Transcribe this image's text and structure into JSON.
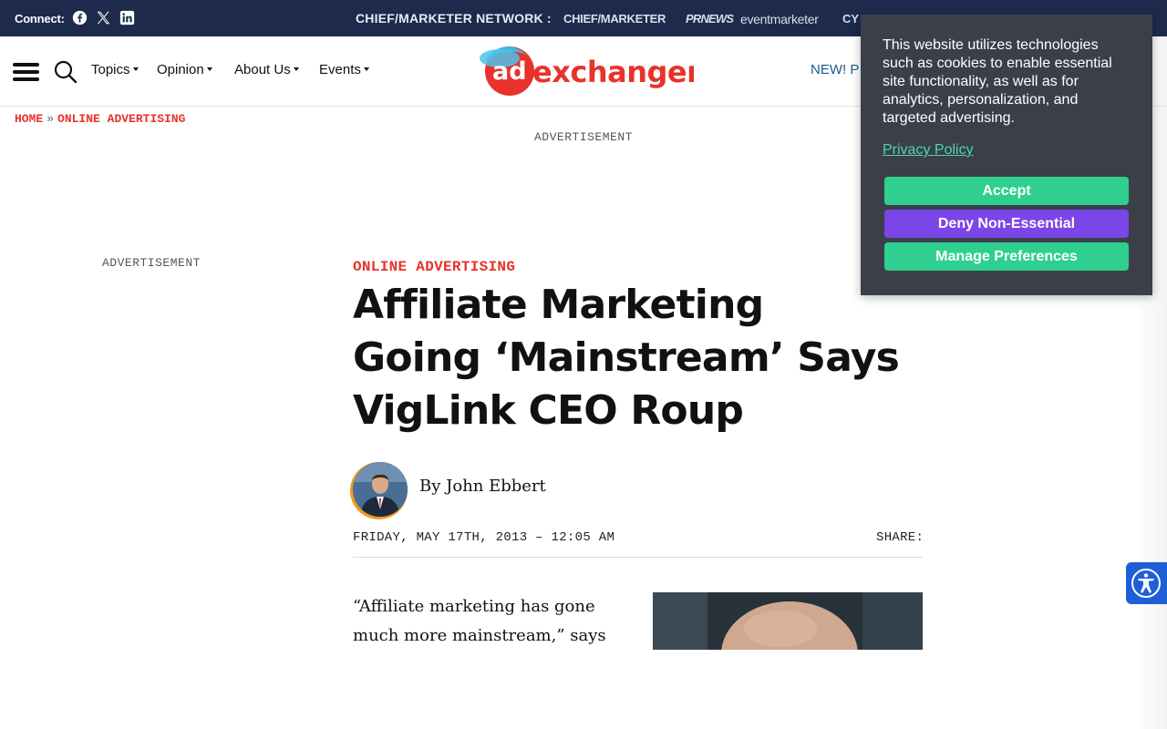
{
  "topbar": {
    "connect_label": "Connect:",
    "social": [
      "facebook-icon",
      "x-icon",
      "linkedin-icon"
    ],
    "network_label": "CHIEF/MARKETER NETWORK :",
    "network_items": [
      "CHIEF/MARKETER",
      "PRNEWS",
      "eventmarketer",
      "CY"
    ]
  },
  "header": {
    "nav": [
      "Topics",
      "Opinion",
      "About Us",
      "Events"
    ],
    "logo": {
      "ad": "ad",
      "word": "exchanger"
    },
    "promo": "NEW! P"
  },
  "breadcrumb": {
    "home": "HOME",
    "separator": "»",
    "section": "ONLINE ADVERTISING"
  },
  "ads": {
    "top_label": "ADVERTISEMENT",
    "left_label": "ADVERTISEMENT"
  },
  "article": {
    "category": "ONLINE ADVERTISING",
    "headline": "Affiliate Marketing Going ‘Mainstream’ Says VigLink CEO Roup",
    "byline_prefix": "By",
    "author": "John Ebbert",
    "date": "FRIDAY, MAY 17TH, 2013 – 12:05 AM",
    "share_label": "SHARE:",
    "lede": "“Affiliate marketing has gone much more mainstream,” says"
  },
  "cookie_banner": {
    "text": "This website utilizes technologies such as cookies to enable essential site functionality, as well as for analytics, personalization, and targeted advertising.",
    "privacy_link": "Privacy Policy",
    "accept": "Accept",
    "deny": "Deny Non-Essential",
    "manage": "Manage Preferences"
  },
  "colors": {
    "topbar_bg": "#1d2a4b",
    "accent_red": "#e8322b",
    "cookie_bg": "#3b3f4a",
    "accept_green": "#2fd08f",
    "deny_purple": "#7b46e8",
    "a11y_blue": "#1f5fd6"
  }
}
